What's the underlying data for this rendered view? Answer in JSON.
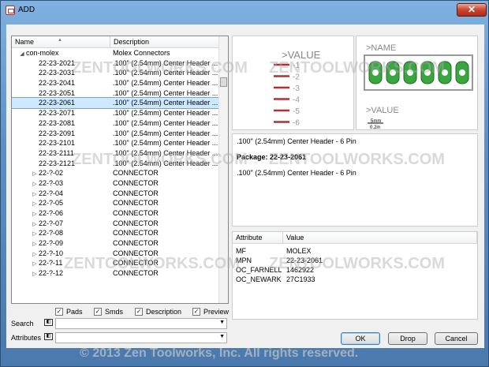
{
  "window": {
    "title": "ADD",
    "close_label": "✕"
  },
  "tree": {
    "col_name": "Name",
    "col_desc": "Description",
    "rows": [
      {
        "indent": 1,
        "exp": "◢",
        "name": "con-molex",
        "desc": "Molex Connectors",
        "sel": false
      },
      {
        "indent": 2,
        "exp": "",
        "name": "22-23-2021",
        "desc": ".100\" (2.54mm) Center Header ...",
        "sel": false
      },
      {
        "indent": 2,
        "exp": "",
        "name": "22-23-2031",
        "desc": ".100\" (2.54mm) Center Header ...",
        "sel": false
      },
      {
        "indent": 2,
        "exp": "",
        "name": "22-23-2041",
        "desc": ".100\" (2.54mm) Center Header ...",
        "sel": false
      },
      {
        "indent": 2,
        "exp": "",
        "name": "22-23-2051",
        "desc": ".100\" (2.54mm) Center Header ...",
        "sel": false
      },
      {
        "indent": 2,
        "exp": "",
        "name": "22-23-2061",
        "desc": ".100\" (2.54mm) Center Header ...",
        "sel": true
      },
      {
        "indent": 2,
        "exp": "",
        "name": "22-23-2071",
        "desc": ".100\" (2.54mm) Center Header ...",
        "sel": false
      },
      {
        "indent": 2,
        "exp": "",
        "name": "22-23-2081",
        "desc": ".100\" (2.54mm) Center Header ...",
        "sel": false
      },
      {
        "indent": 2,
        "exp": "",
        "name": "22-23-2091",
        "desc": ".100\" (2.54mm) Center Header ...",
        "sel": false
      },
      {
        "indent": 2,
        "exp": "",
        "name": "22-23-2101",
        "desc": ".100\" (2.54mm) Center Header ...",
        "sel": false
      },
      {
        "indent": 2,
        "exp": "",
        "name": "22-23-2111",
        "desc": ".100\" (2.54mm) Center Header ...",
        "sel": false
      },
      {
        "indent": 2,
        "exp": "",
        "name": "22-23-2121",
        "desc": ".100\" (2.54mm) Center Header ...",
        "sel": false
      },
      {
        "indent": 2,
        "exp": "▷",
        "name": "22-?-02",
        "desc": "CONNECTOR",
        "sel": false
      },
      {
        "indent": 2,
        "exp": "▷",
        "name": "22-?-03",
        "desc": "CONNECTOR",
        "sel": false
      },
      {
        "indent": 2,
        "exp": "▷",
        "name": "22-?-04",
        "desc": "CONNECTOR",
        "sel": false
      },
      {
        "indent": 2,
        "exp": "▷",
        "name": "22-?-05",
        "desc": "CONNECTOR",
        "sel": false
      },
      {
        "indent": 2,
        "exp": "▷",
        "name": "22-?-06",
        "desc": "CONNECTOR",
        "sel": false
      },
      {
        "indent": 2,
        "exp": "▷",
        "name": "22-?-07",
        "desc": "CONNECTOR",
        "sel": false
      },
      {
        "indent": 2,
        "exp": "▷",
        "name": "22-?-08",
        "desc": "CONNECTOR",
        "sel": false
      },
      {
        "indent": 2,
        "exp": "▷",
        "name": "22-?-09",
        "desc": "CONNECTOR",
        "sel": false
      },
      {
        "indent": 2,
        "exp": "▷",
        "name": "22-?-10",
        "desc": "CONNECTOR",
        "sel": false
      },
      {
        "indent": 2,
        "exp": "▷",
        "name": "22-?-11",
        "desc": "CONNECTOR",
        "sel": false
      },
      {
        "indent": 2,
        "exp": "▷",
        "name": "22-?-12",
        "desc": "CONNECTOR",
        "sel": false
      }
    ]
  },
  "options": {
    "pads": "Pads",
    "smds": "Smds",
    "description": "Description",
    "preview": "Preview"
  },
  "search": {
    "label": "Search",
    "value": ""
  },
  "attributes_filter": {
    "label": "Attributes",
    "value": ""
  },
  "symbol": {
    "value_label": ">VALUE",
    "pins": [
      "-1",
      "-2",
      "-3",
      "-4",
      "-5",
      "-6"
    ]
  },
  "package_view": {
    "name_label": ">NAME",
    "value_label": ">VALUE",
    "scale_top": "5mm",
    "scale_bottom": "0.2in"
  },
  "info": {
    "desc1": ".100\" (2.54mm) Center Header - 6 Pin",
    "package_label": "Package:",
    "package_value": "22-23-2061",
    "desc2": ".100\" (2.54mm) Center Header - 6 Pin"
  },
  "attributes": {
    "col_attr": "Attribute",
    "col_value": "Value",
    "rows": [
      {
        "k": "MF",
        "v": "MOLEX"
      },
      {
        "k": "MPN",
        "v": "22-23-2061"
      },
      {
        "k": "OC_FARNELL",
        "v": "1462922"
      },
      {
        "k": "OC_NEWARK",
        "v": "27C1933"
      }
    ]
  },
  "buttons": {
    "ok": "OK",
    "drop": "Drop",
    "cancel": "Cancel"
  },
  "watermark": {
    "text": "ZENTOOLWORKS.COM",
    "copyright": "© 2013 Zen Toolworks, Inc. All rights reserved."
  }
}
